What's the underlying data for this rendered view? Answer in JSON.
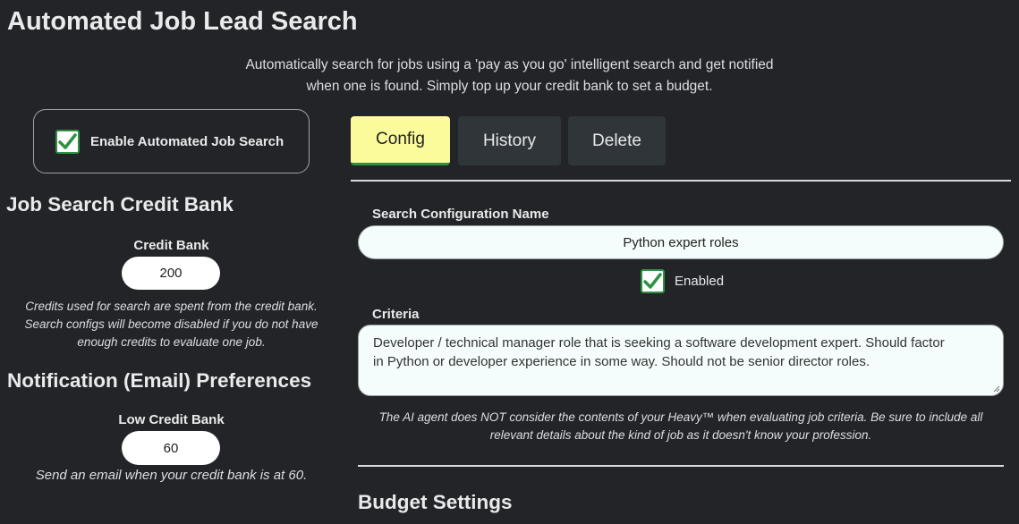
{
  "page": {
    "title": "Automated Job Lead Search",
    "subtitle_line1": "Automatically search for jobs using a 'pay as you go' intelligent search and get notified",
    "subtitle_line2": "when one is found. Simply top up your credit bank to set a budget."
  },
  "enable": {
    "label": "Enable Automated Job Search",
    "checked": true
  },
  "tabs": [
    {
      "label": "Config",
      "active": true
    },
    {
      "label": "History",
      "active": false
    },
    {
      "label": "Delete",
      "active": false
    }
  ],
  "credit": {
    "heading": "Job Search Credit Bank",
    "label": "Credit Bank",
    "value": "200",
    "note_line1": "Credits used for search are spent from the credit bank.",
    "note_line2": "Search configs will become disabled if you do not have",
    "note_line3": "enough credits to evaluate one job."
  },
  "notification": {
    "heading": "Notification (Email) Preferences",
    "label": "Low Credit Bank",
    "value": "60",
    "note": "Send an email when your credit bank is at 60."
  },
  "config": {
    "name_label": "Search Configuration Name",
    "name_value": "Python expert roles",
    "enabled_label": "Enabled",
    "enabled": true,
    "criteria_label": "Criteria",
    "criteria_line1": "Developer / technical manager role that is seeking a software development expert. Should factor",
    "criteria_line2": "in Python or developer experience in some way. Should not be senior director roles.",
    "note_line1": "The AI agent does NOT consider the contents of your Heavy™ when evaluating job criteria. Be sure to include all",
    "note_line2": "relevant details about the kind of job as it doesn't know your profession."
  },
  "budget": {
    "heading": "Budget Settings"
  },
  "colors": {
    "accent_tab": "#fbfb9c",
    "check_green": "#2e9143",
    "background": "#222427",
    "tab_bg": "#30353a"
  }
}
